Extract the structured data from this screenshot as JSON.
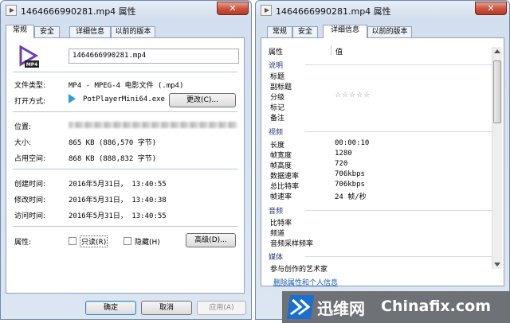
{
  "left_window": {
    "title": "1464666990281.mp4 属性",
    "close_label": "✕",
    "tabs": [
      "常规",
      "安全",
      "详细信息",
      "以前的版本"
    ],
    "filename": "1464666990281.mp4",
    "file_type_label": "文件类型:",
    "file_type_value": "MP4 - MPEG-4 电影文件 (.mp4)",
    "open_with_label": "打开方式:",
    "open_with_value": "PotPlayerMini64.exe",
    "change_button": "更改(C)...",
    "location_label": "位置:",
    "size_label": "大小:",
    "size_value": "865 KB (886,570 字节)",
    "disk_size_label": "占用空间:",
    "disk_size_value": "868 KB (888,832 字节)",
    "created_label": "创建时间:",
    "created_value": "2016年5月31日， 13:40:55",
    "modified_label": "修改时间:",
    "modified_value": "2016年5月31日， 13:40:38",
    "accessed_label": "访问时间:",
    "accessed_value": "2016年5月31日， 13:40:55",
    "attributes_label": "属性:",
    "readonly_label": "只读(R)",
    "hidden_label": "隐藏(H)",
    "advanced_button": "高级(D)...",
    "ok_button": "确定",
    "cancel_button": "取消",
    "apply_button": "应用(A)",
    "icon_caption": "MP4"
  },
  "right_window": {
    "title": "1464666990281.mp4 属性",
    "close_label": "✕",
    "tabs": [
      "常规",
      "安全",
      "详细信息",
      "以前的版本"
    ],
    "col_property": "属性",
    "col_value": "值",
    "groups": {
      "description": "说明",
      "video": "视频",
      "audio": "音频",
      "media": "媒体"
    },
    "description_rows": [
      {
        "name": "标题",
        "value": ""
      },
      {
        "name": "副标题",
        "value": ""
      },
      {
        "name": "分级",
        "value": "☆☆☆☆☆"
      },
      {
        "name": "标记",
        "value": ""
      },
      {
        "name": "备注",
        "value": ""
      }
    ],
    "video_rows": [
      {
        "name": "长度",
        "value": "00:00:10"
      },
      {
        "name": "帧宽度",
        "value": "1280"
      },
      {
        "name": "帧高度",
        "value": "720"
      },
      {
        "name": "数据速率",
        "value": "706kbps"
      },
      {
        "name": "总比特率",
        "value": "706kbps"
      },
      {
        "name": "帧速率",
        "value": "24 帧/秒"
      }
    ],
    "audio_rows": [
      {
        "name": "比特率",
        "value": ""
      },
      {
        "name": "频道",
        "value": ""
      },
      {
        "name": "音频采样频率",
        "value": ""
      }
    ],
    "media_rows": [
      {
        "name": "参与创作的艺术家",
        "value": ""
      }
    ],
    "remove_link": "删除属性和个人信息"
  },
  "watermark": {
    "cn": "迅维网",
    "en": "Chinafix.com"
  },
  "colors": {
    "frame": "#d3dfee",
    "group_header": "#1f3c77",
    "link": "#1a5cae",
    "close": "#c8523c"
  }
}
